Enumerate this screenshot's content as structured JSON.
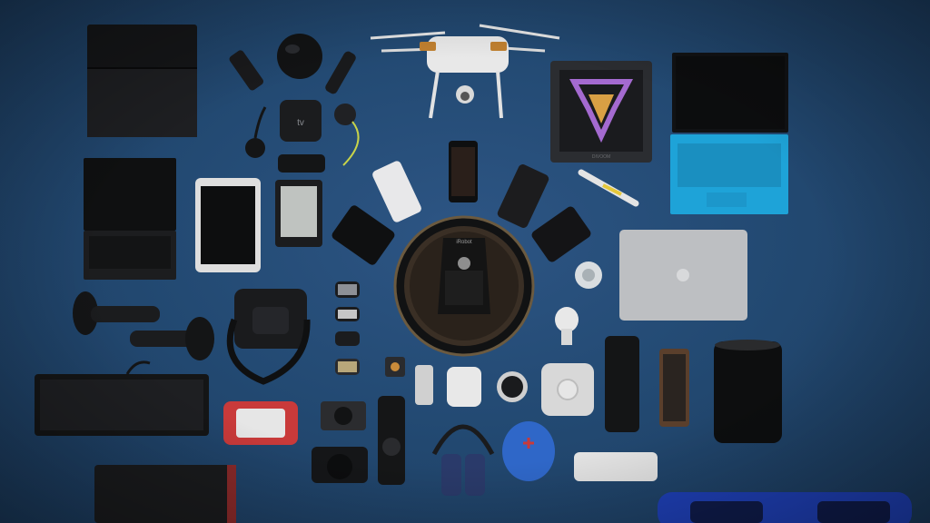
{
  "image": {
    "subject": "flat-lay of consumer electronics on a blue background",
    "background_color": "#24507e",
    "accent_colors": {
      "tablet_keyboard": "#1ea3d8",
      "speaker_blue": "#2f67c8",
      "hoverboard": "#1e3fb5",
      "vr_red": "#c93a3a"
    },
    "printed_text": {
      "set_top_box": "tv",
      "robot_vacuum_brand": "iRobot",
      "led_display_brand": "DIVOOM"
    }
  }
}
